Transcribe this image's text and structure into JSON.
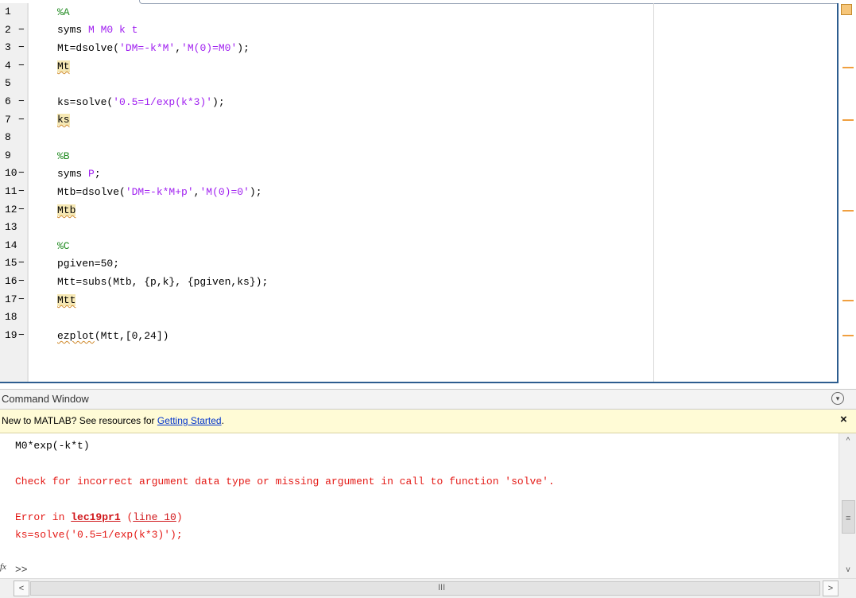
{
  "editor": {
    "lines": [
      {
        "n": "1",
        "exec": false
      },
      {
        "n": "2",
        "exec": true
      },
      {
        "n": "3",
        "exec": true
      },
      {
        "n": "4",
        "exec": true
      },
      {
        "n": "5",
        "exec": false
      },
      {
        "n": "6",
        "exec": true
      },
      {
        "n": "7",
        "exec": true
      },
      {
        "n": "8",
        "exec": false
      },
      {
        "n": "9",
        "exec": false
      },
      {
        "n": "10",
        "exec": true
      },
      {
        "n": "11",
        "exec": true
      },
      {
        "n": "12",
        "exec": true
      },
      {
        "n": "13",
        "exec": false
      },
      {
        "n": "14",
        "exec": false
      },
      {
        "n": "15",
        "exec": true
      },
      {
        "n": "16",
        "exec": true
      },
      {
        "n": "17",
        "exec": true
      },
      {
        "n": "18",
        "exec": false
      },
      {
        "n": "19",
        "exec": true
      }
    ],
    "dash": "−",
    "code": {
      "l1": "%A",
      "l2_a": "syms ",
      "l2_b": "M M0 k t",
      "l3_a": "Mt=dsolve(",
      "l3_b": "'DM=-k*M'",
      "l3_c": ",",
      "l3_d": "'M(0)=M0'",
      "l3_e": ");",
      "l4": "Mt",
      "l6_a": "ks=solve(",
      "l6_b": "'0.5=1/exp(k*3)'",
      "l6_c": ");",
      "l7": "ks",
      "l9": "%B",
      "l10_a": "syms ",
      "l10_b": "P",
      "l10_c": ";",
      "l11_a": "Mtb=dsolve(",
      "l11_b": "'DM=-k*M+p'",
      "l11_c": ",",
      "l11_d": "'M(0)=0'",
      "l11_e": ");",
      "l12": "Mtb",
      "l14": "%C",
      "l15": "pgiven=50;",
      "l16": "Mtt=subs(Mtb, {p,k}, {pgiven,ks});",
      "l17": "Mtt",
      "l19_a": "ezplot",
      "l19_b": "(Mtt,[0,24])"
    }
  },
  "command_window": {
    "title": "Command Window",
    "menu_icon": "chevron-down-circle",
    "banner": {
      "prefix": "New to MATLAB? See resources for ",
      "link": "Getting Started",
      "suffix": ".",
      "close": "×"
    },
    "output": {
      "result": "M0*exp(-k*t)",
      "error_msg": "Check for incorrect argument data type or missing argument in call to function 'solve'.",
      "error_in_prefix": "Error in ",
      "error_file": "lec19pr1",
      "error_line_open": " (",
      "error_line": "line 10",
      "error_line_close": ")",
      "error_code": "ks=solve('0.5=1/exp(k*3)');"
    },
    "fx": "fx",
    "prompt": ">>"
  },
  "scrollbars": {
    "up": "^",
    "down": "v",
    "left": "<",
    "right": ">",
    "grip_v": "≡",
    "grip_h": "III"
  },
  "colors": {
    "comment": "#228B22",
    "string": "#A020F0",
    "error": "#E41B17",
    "highlight": "#F5E7B3",
    "banner_bg": "#FFFBD6",
    "link": "#0033CC"
  }
}
